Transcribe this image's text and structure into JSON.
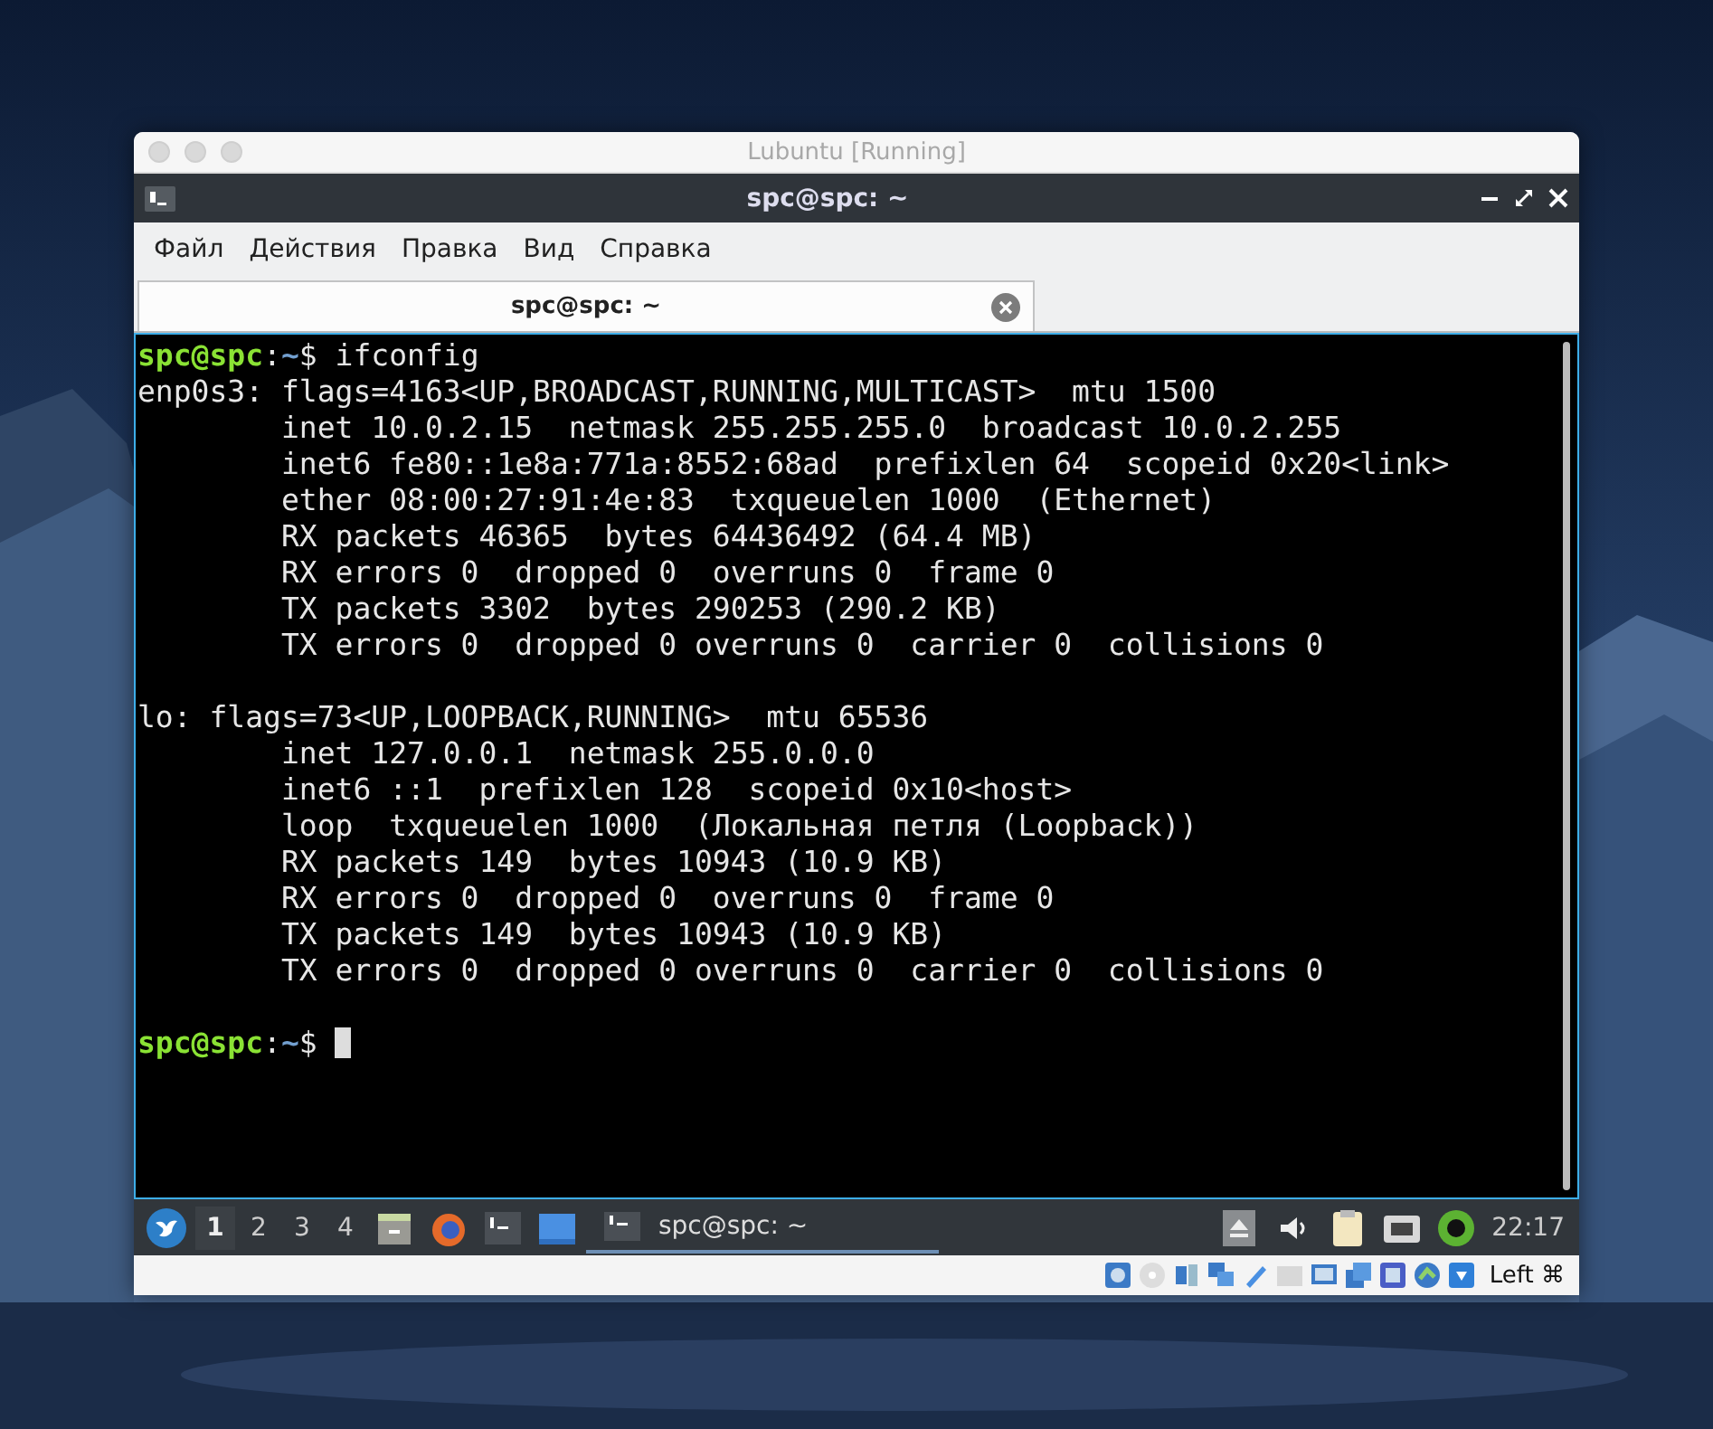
{
  "vm_window": {
    "title": "Lubuntu [Running]",
    "host_key": "Left ⌘"
  },
  "terminal": {
    "title": "spc@spc: ~",
    "menu": [
      "Файл",
      "Действия",
      "Правка",
      "Вид",
      "Справка"
    ],
    "tabs": [
      {
        "label": "spc@spc: ~",
        "selected": true
      }
    ],
    "lines": [
      {
        "kind": "prompt",
        "user_host": "spc@spc",
        "separator": ":",
        "path": "~",
        "command": "$ ifconfig",
        "cursor": false
      },
      {
        "kind": "output",
        "text": "enp0s3: flags=4163<UP,BROADCAST,RUNNING,MULTICAST>  mtu 1500"
      },
      {
        "kind": "output",
        "text": "        inet 10.0.2.15  netmask 255.255.255.0  broadcast 10.0.2.255"
      },
      {
        "kind": "output",
        "text": "        inet6 fe80::1e8a:771a:8552:68ad  prefixlen 64  scopeid 0x20<link>"
      },
      {
        "kind": "output",
        "text": "        ether 08:00:27:91:4e:83  txqueuelen 1000  (Ethernet)"
      },
      {
        "kind": "output",
        "text": "        RX packets 46365  bytes 64436492 (64.4 MB)"
      },
      {
        "kind": "output",
        "text": "        RX errors 0  dropped 0  overruns 0  frame 0"
      },
      {
        "kind": "output",
        "text": "        TX packets 3302  bytes 290253 (290.2 KB)"
      },
      {
        "kind": "output",
        "text": "        TX errors 0  dropped 0 overruns 0  carrier 0  collisions 0"
      },
      {
        "kind": "blank"
      },
      {
        "kind": "output",
        "text": "lo: flags=73<UP,LOOPBACK,RUNNING>  mtu 65536"
      },
      {
        "kind": "output",
        "text": "        inet 127.0.0.1  netmask 255.0.0.0"
      },
      {
        "kind": "output",
        "text": "        inet6 ::1  prefixlen 128  scopeid 0x10<host>"
      },
      {
        "kind": "output",
        "text": "        loop  txqueuelen 1000  (Локальная петля (Loopback))"
      },
      {
        "kind": "output",
        "text": "        RX packets 149  bytes 10943 (10.9 KB)"
      },
      {
        "kind": "output",
        "text": "        RX errors 0  dropped 0  overruns 0  frame 0"
      },
      {
        "kind": "output",
        "text": "        TX packets 149  bytes 10943 (10.9 KB)"
      },
      {
        "kind": "output",
        "text": "        TX errors 0  dropped 0 overruns 0  carrier 0  collisions 0"
      },
      {
        "kind": "blank"
      },
      {
        "kind": "prompt",
        "user_host": "spc@spc",
        "separator": ":",
        "path": "~",
        "command": "$ ",
        "cursor": true
      }
    ]
  },
  "taskbar": {
    "workspaces": [
      {
        "label": "1",
        "selected": true
      },
      {
        "label": "2",
        "selected": false
      },
      {
        "label": "3",
        "selected": false
      },
      {
        "label": "4",
        "selected": false
      }
    ],
    "tasks": [
      {
        "label": "spc@spc: ~",
        "selected": true
      }
    ],
    "clock": "22:17"
  }
}
